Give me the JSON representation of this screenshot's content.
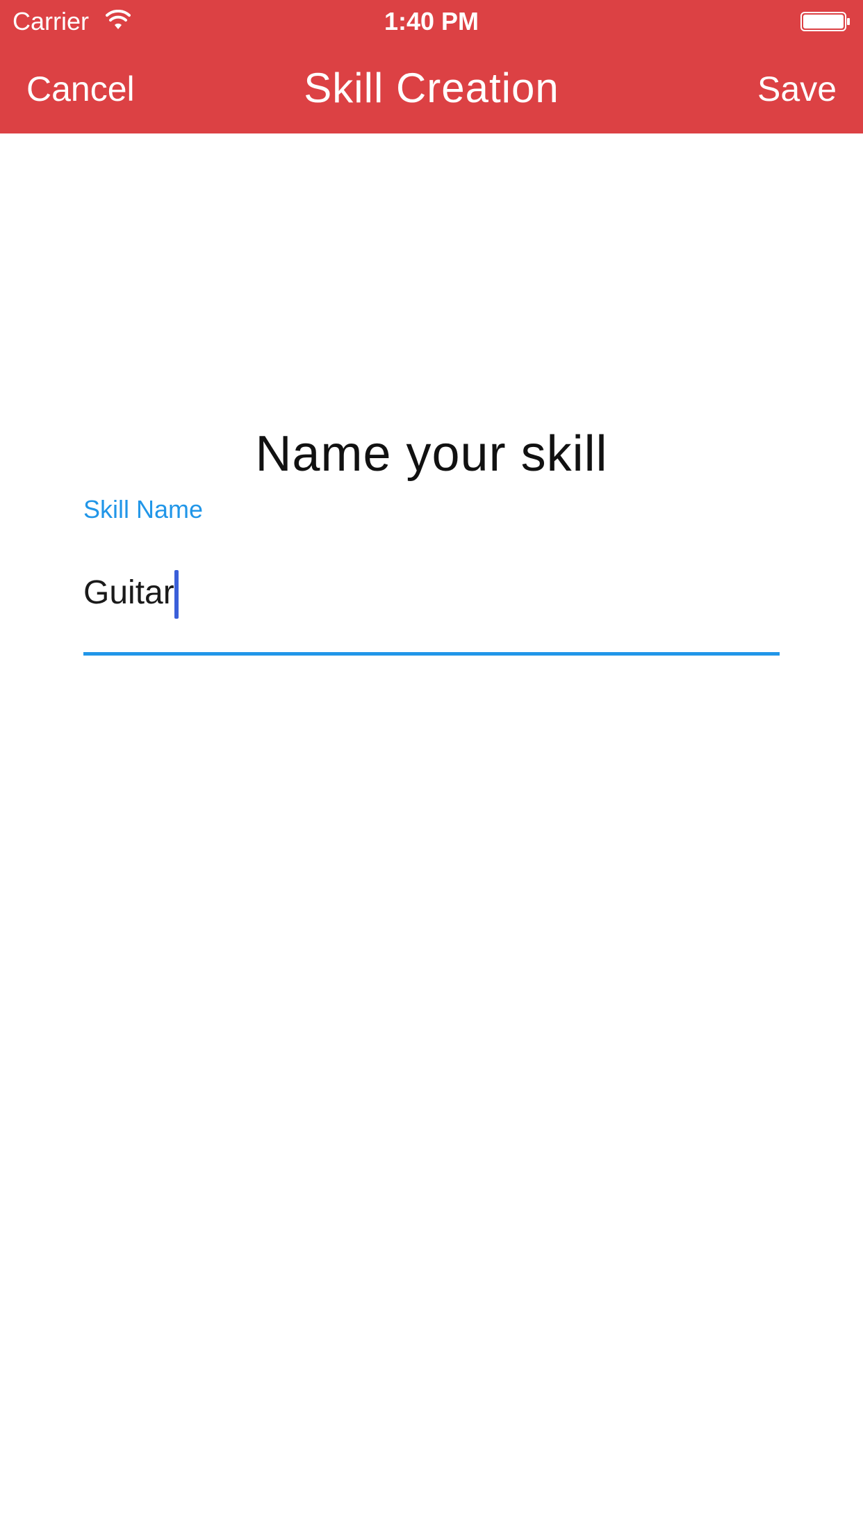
{
  "status_bar": {
    "carrier": "Carrier",
    "time": "1:40 PM",
    "wifi_icon": "wifi-icon",
    "battery_icon": "battery-icon"
  },
  "nav": {
    "cancel_label": "Cancel",
    "title": "Skill Creation",
    "save_label": "Save"
  },
  "content": {
    "prompt": "Name your skill",
    "field_label": "Skill Name",
    "field_value": "Guitar"
  },
  "colors": {
    "header_background": "#dc4144",
    "accent": "#2196e8",
    "caret": "#3a5fd9"
  }
}
